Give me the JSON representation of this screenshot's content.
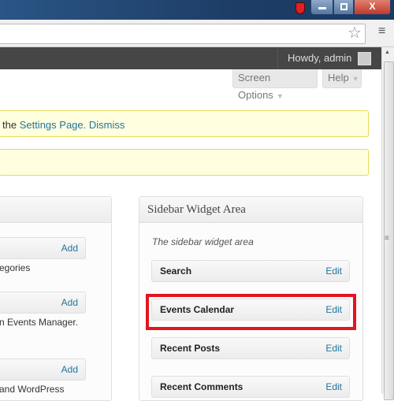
{
  "browser": {
    "close_label": "X"
  },
  "admin_bar": {
    "greeting": "Howdy, admin"
  },
  "screen_tabs": {
    "screen_options": "Screen Options",
    "help": "Help",
    "arrow": "▼"
  },
  "notices": {
    "prefix": "the ",
    "settings_link": "Settings Page.",
    "dismiss_link": "Dismiss"
  },
  "available_widgets": [
    {
      "action": "Add",
      "description": "egories"
    },
    {
      "action": "Add",
      "description": "n Events Manager."
    },
    {
      "action": "Add",
      "description": "and WordPress"
    }
  ],
  "sidebar": {
    "title": "Sidebar Widget Area",
    "description": "The sidebar widget area",
    "widgets": [
      {
        "title": "Search",
        "action": "Edit"
      },
      {
        "title": "Events Calendar",
        "action": "Edit",
        "highlighted": true
      },
      {
        "title": "Recent Posts",
        "action": "Edit"
      },
      {
        "title": "Recent Comments",
        "action": "Edit"
      }
    ]
  },
  "colors": {
    "highlight": "#e3151f",
    "link": "#21759b",
    "notice_bg": "#ffffe0"
  }
}
